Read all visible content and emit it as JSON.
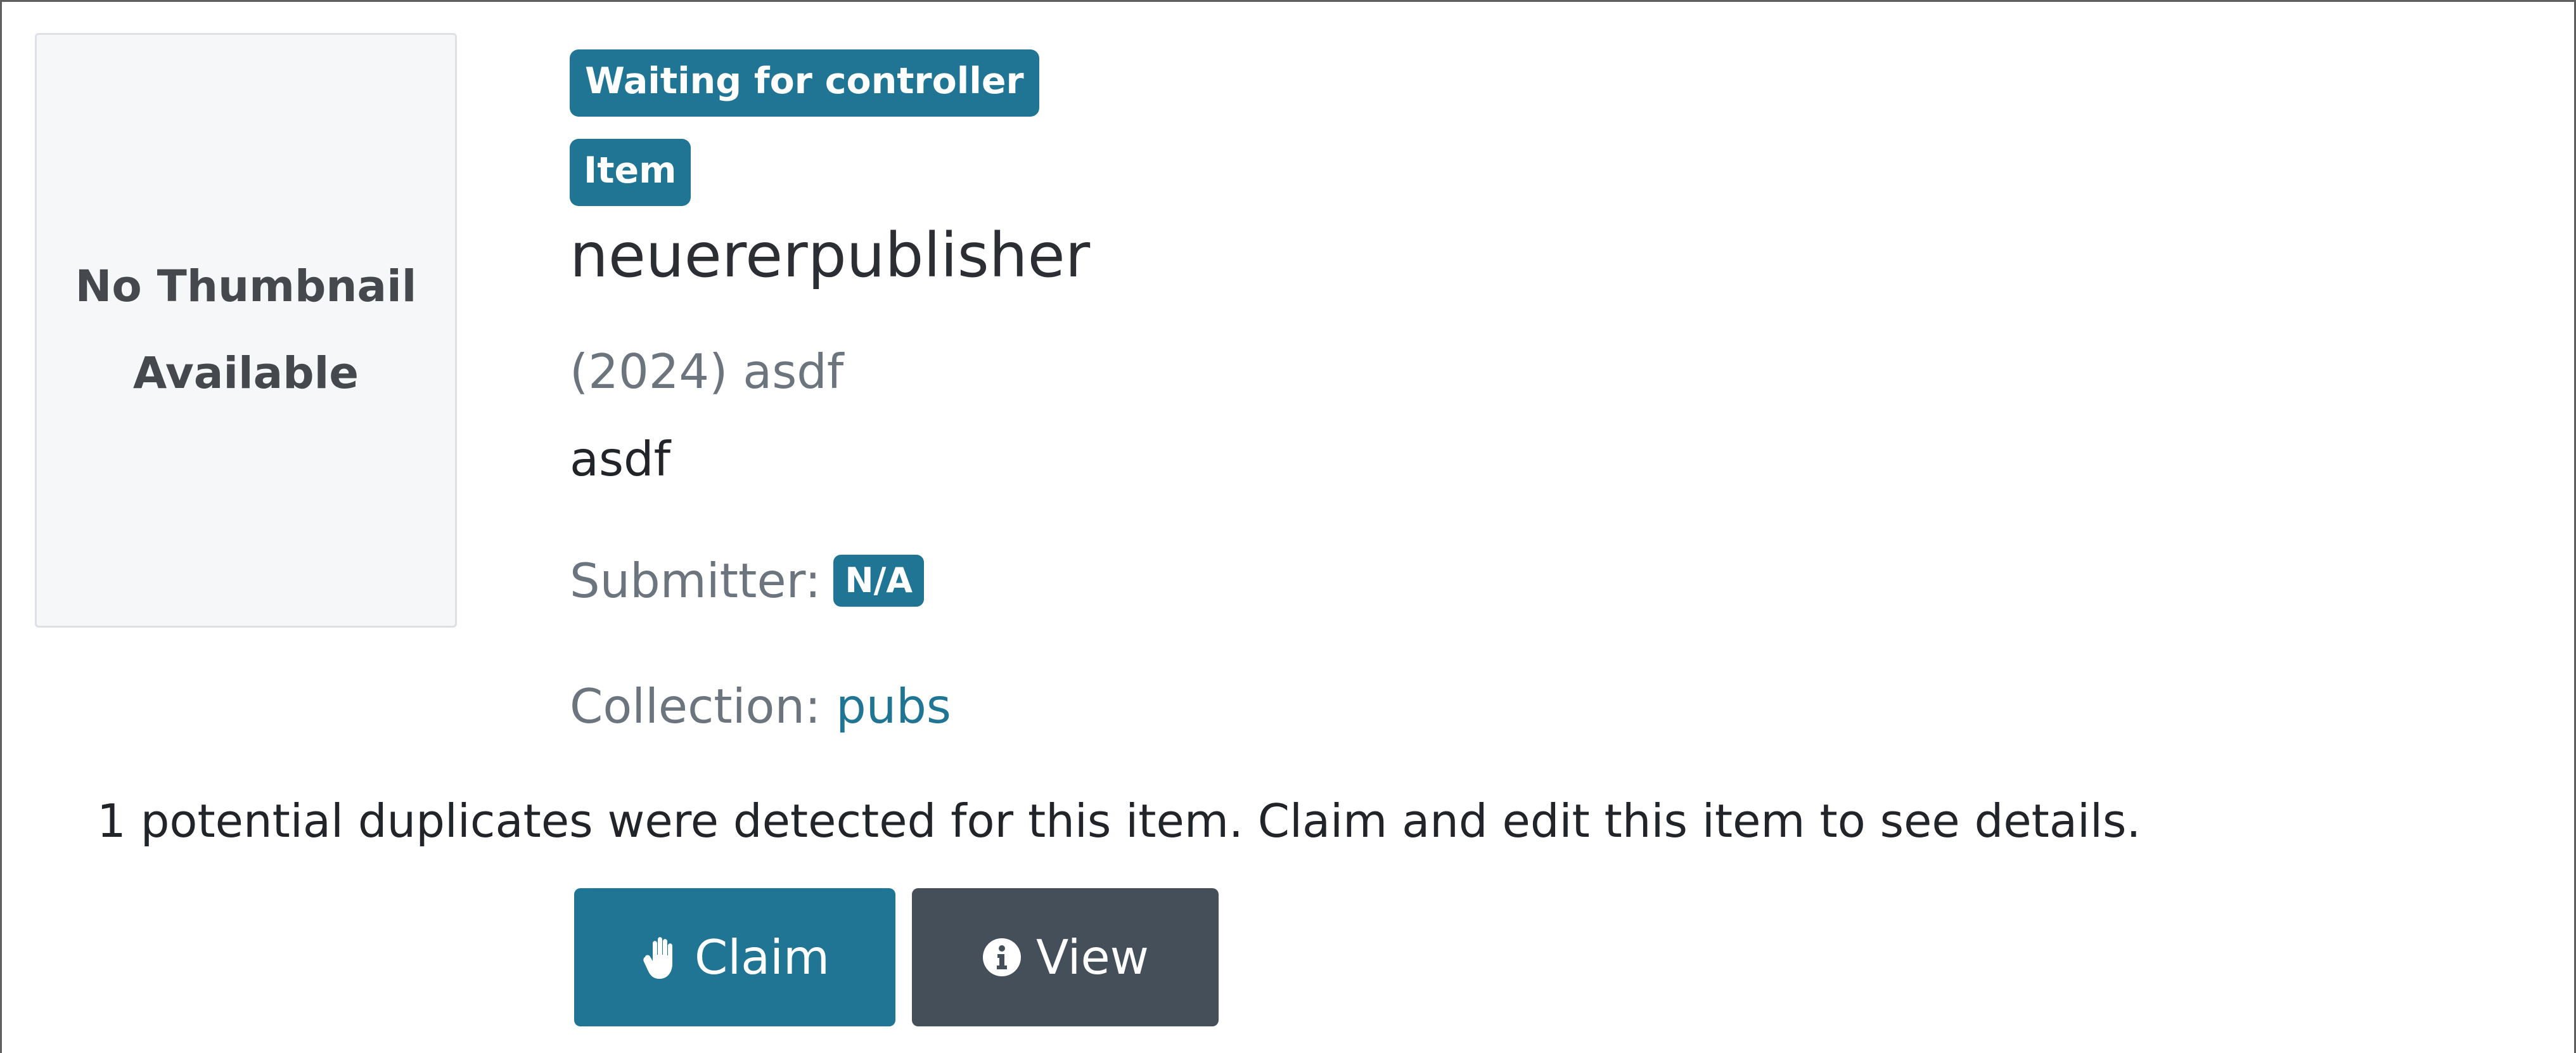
{
  "thumbnail": {
    "line1": "No Thumbnail",
    "line2": "Available"
  },
  "badges": {
    "status": "Waiting for controller",
    "type": "Item"
  },
  "item": {
    "title": "neuererpublisher",
    "meta": "(2024) asdf",
    "abstract": "asdf"
  },
  "submitter": {
    "label": "Submitter:",
    "value": "N/A"
  },
  "collection": {
    "label": "Collection:",
    "value": "pubs"
  },
  "duplicates_message": "1 potential duplicates were detected for this item. Claim and edit this item to see details.",
  "actions": {
    "claim_label": "Claim",
    "claim_icon": "hand-paper-icon",
    "view_label": "View",
    "view_icon": "info-circle-icon"
  },
  "colors": {
    "primary": "#1f7593",
    "secondary": "#454f5a",
    "muted_text": "#6c757d"
  }
}
